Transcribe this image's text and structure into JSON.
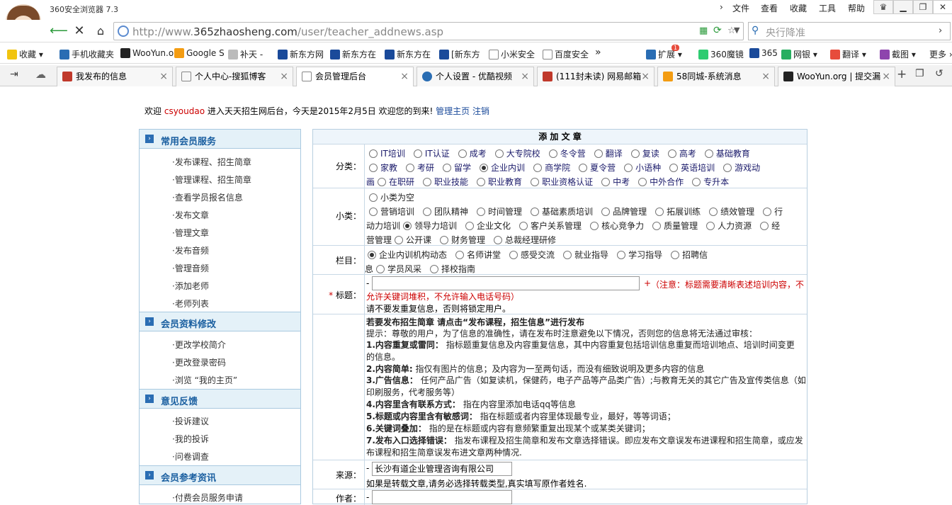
{
  "titlebar": {
    "app_title": "360安全浏览器 7.3",
    "menus": [
      "文件",
      "查看",
      "收藏",
      "工具",
      "帮助"
    ]
  },
  "addressbar": {
    "url_prefix": "http://www.",
    "url_domain": "365zhaosheng.com",
    "url_path": "/user/teacher_addnews.asp",
    "search_placeholder": "央行降准"
  },
  "bookmarks": [
    "收藏",
    "手机收藏夹",
    "WooYun.o",
    "Google S",
    "补天 -",
    "新东方网",
    "新东方在",
    "新东方在",
    "[新东方",
    "小米安全",
    "百度安全",
    "扩展",
    "360魔镜",
    "365",
    "网银",
    "翻译",
    "截图",
    "更多"
  ],
  "extension_badge": "1",
  "tabs": [
    {
      "label": "我发布的信息",
      "color": "#c0392b"
    },
    {
      "label": "个人中心-搜狐博客",
      "color": "#888888"
    },
    {
      "label": "会员管理后台",
      "color": "#888888"
    },
    {
      "label": "个人设置 - 优酷视频",
      "color": "#2a6db3"
    },
    {
      "label": "(111封未读) 网易邮箱",
      "color": "#c0392b"
    },
    {
      "label": "58同城-系统消息",
      "color": "#f39c12"
    },
    {
      "label": "WooYun.org | 提交漏",
      "color": "#222222"
    }
  ],
  "welcome": {
    "prefix": "欢迎",
    "user": "csyoudao",
    "middle": "进入天天招生网后台，今天是2015年2月5日 欢迎您的到来!",
    "link_home": "管理主页",
    "link_logout": "注销"
  },
  "sidebar": {
    "sections": [
      {
        "title": "常用会员服务",
        "items": [
          "·发布课程、招生简章",
          "·管理课程、招生简章",
          "·查看学员报名信息",
          "·发布文章",
          "·管理文章",
          "·发布音频",
          "·管理音频",
          "·添加老师",
          "·老师列表"
        ]
      },
      {
        "title": "会员资料修改",
        "items": [
          "·更改学校简介",
          "·更改登录密码",
          "·浏览 “我的主页”"
        ]
      },
      {
        "title": "意见反馈",
        "items": [
          "·投诉建议",
          "·我的投诉",
          "·问卷调查"
        ]
      },
      {
        "title": "会员参考资讯",
        "items": [
          "·付费会员服务申请"
        ]
      }
    ]
  },
  "form": {
    "title": "添 加 文 章",
    "category_label": "分类：",
    "category_lines": [
      [
        "IT培训",
        "IT认证",
        "成考",
        "大专院校",
        "冬令营",
        "翻译",
        "复读",
        "高考",
        "基础教育"
      ],
      [
        "家教",
        "考研",
        "留学",
        "企业内训",
        "商学院",
        "夏令营",
        "小语种",
        "英语培训",
        "游戏动"
      ],
      [
        "画",
        "在职研",
        "职业技能",
        "职业教育",
        "职业资格认证",
        "中考",
        "中外合作",
        "专升本"
      ]
    ],
    "category_selected": "企业内训",
    "subcat_label": "小类：",
    "subcat_lines": [
      [
        "小类为空"
      ],
      [
        "营销培训",
        "团队精神",
        "时间管理",
        "基础素质培训",
        "品牌管理",
        "拓展训练",
        "绩效管理",
        "行"
      ],
      [
        "动力培训",
        "领导力培训",
        "企业文化",
        "客户关系管理",
        "核心竞争力",
        "质量管理",
        "人力资源",
        "经"
      ],
      [
        "营管理",
        "公开课",
        "财务管理",
        "总裁经理研修"
      ]
    ],
    "subcat_selected": "领导力培训",
    "column_label": "栏目：",
    "column_lines": [
      [
        "企业内训机构动态",
        "名师讲堂",
        "感受交流",
        "就业指导",
        "学习指导",
        "招聘信"
      ],
      [
        "息",
        "学员风采",
        "择校指南"
      ]
    ],
    "column_selected": "企业内训机构动态",
    "title_label": "标题：",
    "title_required": "*",
    "title_dash": "-",
    "title_plus": "+",
    "title_note_1": "（注意：标题需要清晰表述培训内容，不",
    "title_note_2": "允许关键词堆积，不允许输入电话号码）",
    "title_note_3": "请不要发重复信息，否则将锁定用户。",
    "notice_header": "若要发布招生简章 请点击“发布课程，招生信息”进行发布",
    "notice_lines": [
      {
        "b": "",
        "t": "提示：尊敬的用户，为了信息的准确性，请在发布时注意避免以下情况，否则您的信息将无法通过审核："
      },
      {
        "b": "1.内容重复或雷同：",
        "t": " 指标题重复信息及内容重复信息，其中内容重复包括培训信息重复而培训地点、培训时间变更"
      },
      {
        "b": "",
        "t": "的信息。"
      },
      {
        "b": "2.内容简单:",
        "t": " 指仅有图片的信息；及内容为一至两句话，而没有细致说明及更多内容的信息"
      },
      {
        "b": "3.广告信息：",
        "t": " 任何产品广告（如复读机，保健药，电子产品等产品类广告）;与教育无关的其它广告及宣传类信息（如"
      },
      {
        "b": "",
        "t": "印刷服务，代考服务等）"
      },
      {
        "b": "4.内容里含有联系方式：",
        "t": " 指在内容里添加电话qq等信息"
      },
      {
        "b": "5.标题或内容里含有敏感词：",
        "t": " 指在标题或者内容里体现最专业，最好，等等词语；"
      },
      {
        "b": "6.关键词叠加：",
        "t": " 指的是在标题或内容有意频繁重复出现某个或某类关键词；"
      },
      {
        "b": "7.发布入口选择错误：",
        "t": " 指发布课程及招生简章和发布文章选择错误。即应发布文章误发布进课程和招生简章，或应发"
      },
      {
        "b": "",
        "t": "布课程和招生简章误发布进文章两种情况."
      }
    ],
    "source_label": "来源：",
    "source_dash": "-",
    "source_value": "长沙有道企业管理咨询有限公司",
    "source_hint": "如果是转载文章,请务必选择转载类型,真实填写原作者姓名.",
    "author_label": "作者：",
    "author_dash": "-",
    "author_value": ""
  }
}
